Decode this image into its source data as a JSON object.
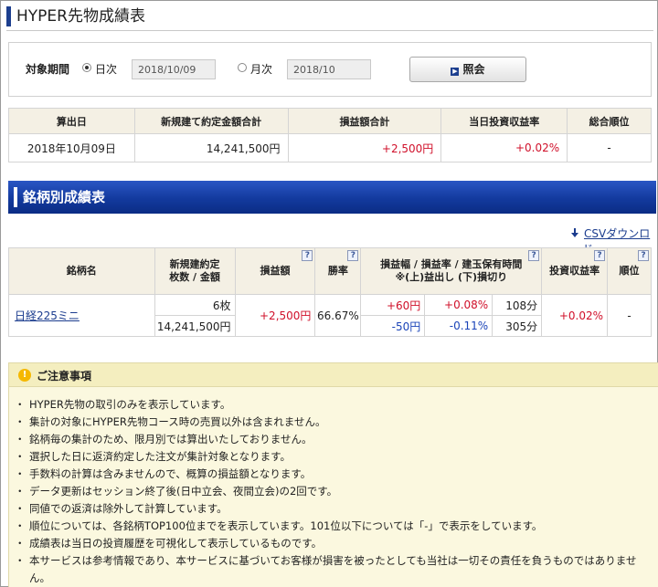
{
  "page": {
    "title": "HYPER先物成績表"
  },
  "search": {
    "label": "対象期間",
    "daily_label": "日次",
    "daily_value": "2018/10/09",
    "monthly_label": "月次",
    "monthly_value": "2018/10",
    "lookup_label": "照会",
    "selected": "daily"
  },
  "summary": {
    "headers": [
      "算出日",
      "新規建て約定金額合計",
      "損益額合計",
      "当日投資収益率",
      "総合順位"
    ],
    "row": [
      "2018年10月09日",
      "14,241,500円",
      "+2,500円",
      "+0.02%",
      "-"
    ]
  },
  "section": {
    "title": "銘柄別成績表",
    "csv_label": "CSVダウンロード"
  },
  "detail": {
    "headers": {
      "name": "銘柄名",
      "contract_1": "新規建約定",
      "contract_2": "枚数 / 金額",
      "pl": "損益額",
      "winrate": "勝率",
      "range_1": "損益幅 / 損益率 / 建玉保有時間",
      "range_2": "※(上)益出し (下)損切り",
      "roi": "投資収益率",
      "rank": "順位",
      "help": "?"
    },
    "row": {
      "name": "日経225ミニ",
      "lots": "6枚",
      "amount": "14,241,500円",
      "pl": "+2,500円",
      "winrate": "66.67%",
      "gain_width": "+60円",
      "gain_rate": "+0.08%",
      "gain_time": "108分",
      "loss_width": "-50円",
      "loss_rate": "-0.11%",
      "loss_time": "305分",
      "roi": "+0.02%",
      "rank": "-"
    }
  },
  "notice": {
    "title": "ご注意事項",
    "items": [
      "HYPER先物の取引のみを表示しています。",
      "集計の対象にHYPER先物コース時の売買以外は含まれません。",
      "銘柄毎の集計のため、限月別では算出いたしておりません。",
      "選択した日に返済約定した注文が集計対象となります。",
      "手数料の計算は含みませんので、概算の損益額となります。",
      "データ更新はセッション終了後(日中立会、夜間立会)の2回です。",
      "同値での返済は除外して計算しています。",
      "順位については、各銘柄TOP100位までを表示しています。101位以下については「-」で表示をしています。",
      "成績表は当日の投資履歴を可視化して表示しているものです。",
      "本サービスは参考情報であり、本サービスに基づいてお客様が損害を被ったとしても当社は一切その責任を負うものではありません。"
    ]
  },
  "colors": {
    "accent": "#1d3f8f",
    "positive": "#d0102a",
    "negative": "#1b44b8",
    "header_bg": "#f4f0e4"
  }
}
